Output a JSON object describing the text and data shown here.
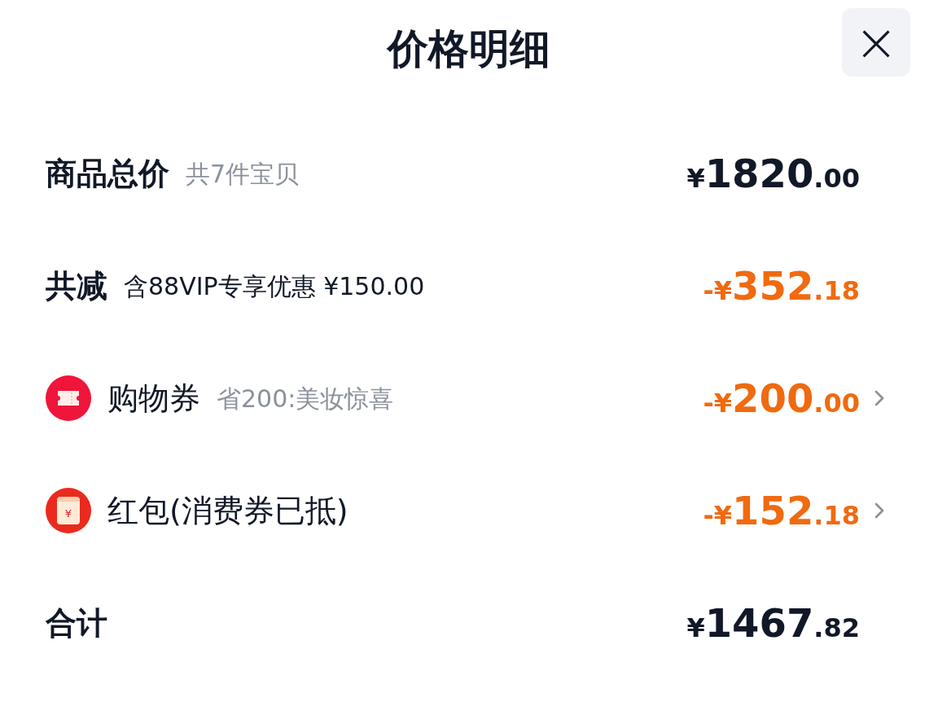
{
  "header": {
    "title": "价格明细",
    "close": "×"
  },
  "rows": [
    {
      "kind": "plain",
      "label": "商品总价",
      "label_bold": true,
      "note": "共7件宝贝",
      "note_muted": true,
      "price": {
        "prefix": "¥",
        "integer": "1820",
        "decimal": ".00"
      },
      "highlight": false,
      "link": false
    },
    {
      "kind": "plain",
      "label": "共减",
      "label_bold": true,
      "note": "含88VIP专享优惠 ¥150.00",
      "note_muted": false,
      "price": {
        "prefix": "-¥",
        "integer": "352",
        "decimal": ".18"
      },
      "highlight": true,
      "link": false
    },
    {
      "kind": "ticket",
      "label": "购物券",
      "label_bold": false,
      "note": "省200:美妆惊喜",
      "note_muted": true,
      "price": {
        "prefix": "-¥",
        "integer": "200",
        "decimal": ".00"
      },
      "highlight": true,
      "link": true
    },
    {
      "kind": "envelope",
      "label": "红包(消费券已抵)",
      "label_bold": false,
      "symbol": "¥",
      "price": {
        "prefix": "-¥",
        "integer": "152",
        "decimal": ".18"
      },
      "highlight": true,
      "link": true
    },
    {
      "kind": "plain",
      "label": "合计",
      "label_bold": true,
      "price": {
        "prefix": "¥",
        "integer": "1467",
        "decimal": ".82"
      },
      "highlight": false,
      "link": false
    }
  ]
}
